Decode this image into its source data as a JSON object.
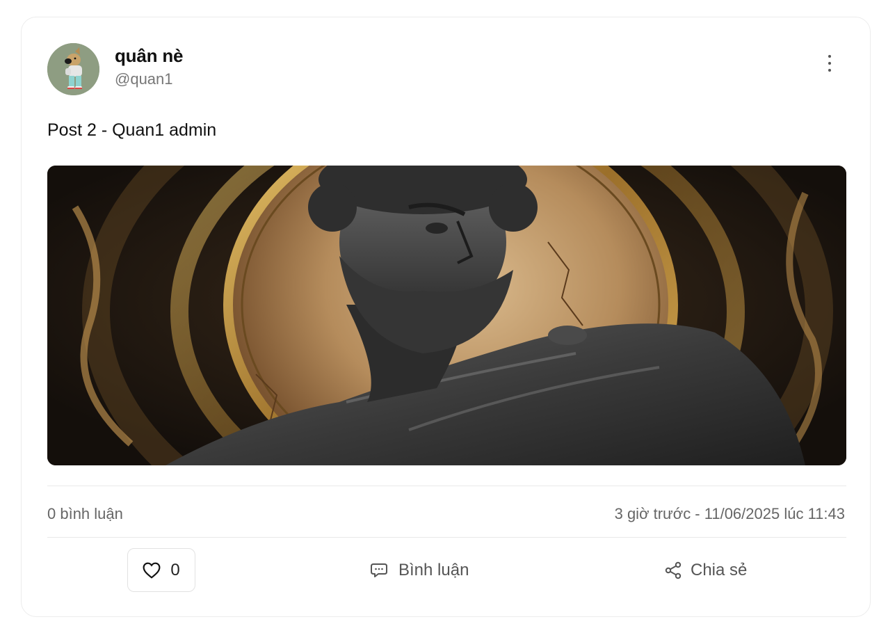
{
  "post": {
    "author": {
      "name": "quân nè",
      "handle": "@quan1"
    },
    "text": "Post 2 - Quan1 admin",
    "comments_summary": "0 bình luận",
    "timestamp": "3 giờ trước - 11/06/2025 lúc 11:43",
    "actions": {
      "like_count": "0",
      "comment_label": "Bình luận",
      "share_label": "Chia sẻ"
    }
  },
  "icons": {
    "more": "more-vertical-icon",
    "like": "heart-icon",
    "comment": "chat-bubbles-icon",
    "share": "share-nodes-icon"
  },
  "colors": {
    "card_border": "#ececec",
    "text_primary": "#111111",
    "text_secondary": "#666666",
    "avatar_bg": "#8e9d82"
  }
}
